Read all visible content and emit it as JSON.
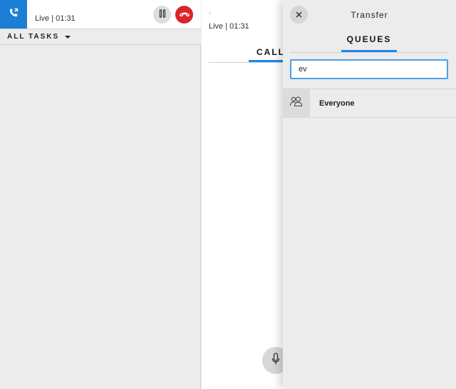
{
  "task_card": {
    "status": "Live | 01:31",
    "type_icon": "phone-transfer-icon",
    "hold_icon": "pause-icon",
    "end_icon": "hang-up-icon"
  },
  "task_filter": {
    "label": "ALL TASKS"
  },
  "call_detail": {
    "caller_name": ".",
    "status": "Live | 01:31",
    "tab_label": "CALL",
    "mic_icon": "microphone-icon"
  },
  "transfer": {
    "title": "Transfer",
    "tab_label": "QUEUES",
    "search_value": "ev",
    "queues": [
      {
        "name": "Everyone",
        "icon": "group-icon"
      }
    ]
  },
  "colors": {
    "accent": "#1e88e5",
    "call_tile": "#1b7fd6",
    "end_call": "#d9252b",
    "background": "#ececec"
  }
}
